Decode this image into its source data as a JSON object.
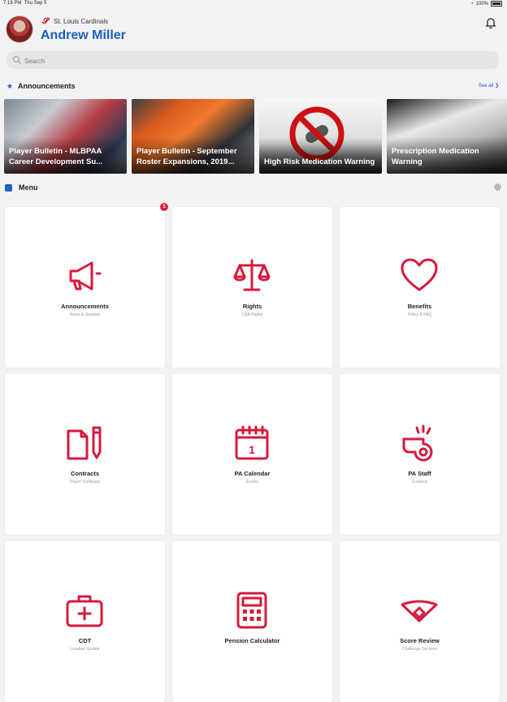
{
  "status_bar": {
    "time": "7:19 PM",
    "date": "Thu Sep 5",
    "battery": "100%"
  },
  "header": {
    "team_name": "St. Louis Cardinals",
    "user_name": "Andrew Miller"
  },
  "search": {
    "placeholder": "Search"
  },
  "announcements": {
    "title": "Announcements",
    "see_all": "See all",
    "cards": [
      {
        "caption": "Player Bulletin - MLBPAA Career Development Su..."
      },
      {
        "caption": "Player Bulletin - September Roster Expansions, 2019..."
      },
      {
        "caption": "High Risk Medication Warning"
      },
      {
        "caption": "Prescription Medication Warning"
      }
    ]
  },
  "menu": {
    "title": "Menu",
    "badge_count": "1",
    "tiles": [
      {
        "title": "Announcements",
        "subtitle": "News & Updates",
        "icon": "megaphone-icon"
      },
      {
        "title": "Rights",
        "subtitle": "CBA Rights",
        "icon": "scales-icon"
      },
      {
        "title": "Benefits",
        "subtitle": "Policy & FAQ",
        "icon": "heart-icon"
      },
      {
        "title": "Contracts",
        "subtitle": "Player Contracts",
        "icon": "contract-icon"
      },
      {
        "title": "PA Calendar",
        "subtitle": "Events",
        "icon": "calendar-icon"
      },
      {
        "title": "PA Staff",
        "subtitle": "Contacts",
        "icon": "whistle-icon"
      },
      {
        "title": "CDT",
        "subtitle": "Location Update",
        "icon": "medkit-icon"
      },
      {
        "title": "Pension Calculator",
        "subtitle": "",
        "icon": "calculator-icon"
      },
      {
        "title": "Score Review",
        "subtitle": "Challenge Decision",
        "icon": "field-icon"
      }
    ]
  },
  "colors": {
    "accent": "#1d5fc4",
    "brand_red": "#c8102e",
    "badge": "#e0243e"
  }
}
